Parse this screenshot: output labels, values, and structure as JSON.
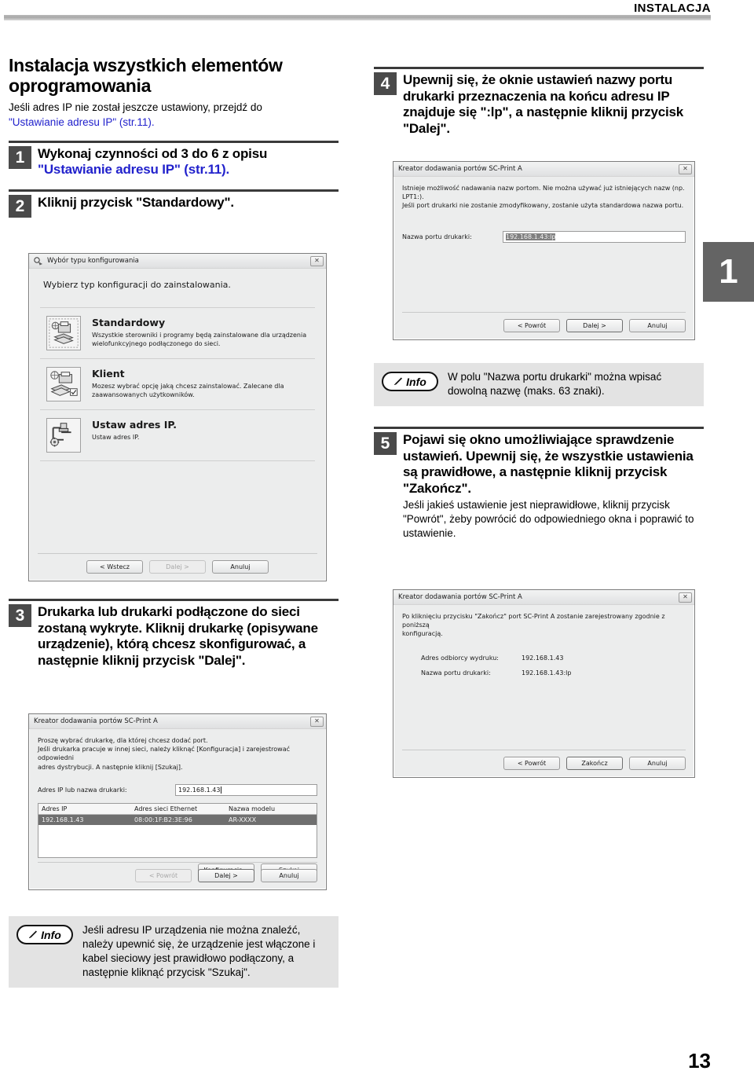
{
  "header": {
    "title": "INSTALACJA"
  },
  "side_tab": {
    "label": "1"
  },
  "footer": {
    "page_number": "13"
  },
  "section": {
    "title": "Instalacja wszystkich elementów oprogramowania",
    "intro_line1": "Jeśli adres IP nie został jeszcze ustawiony, przejdź do",
    "intro_link": "\"Ustawianie adresu IP\" (str.11)."
  },
  "steps": {
    "s1": {
      "num": "1",
      "head_plain": "Wykonaj czynności od 3 do 6 z opisu ",
      "head_link": "\"Ustawianie adresu IP\" (str.11)."
    },
    "s2": {
      "num": "2",
      "head": "Kliknij przycisk \"Standardowy\"."
    },
    "s3": {
      "num": "3",
      "head": "Drukarka lub drukarki podłączone do sieci zostaną wykryte. Kliknij drukarkę (opisywane urządzenie), którą chcesz skonfigurować, a następnie kliknij przycisk \"Dalej\"."
    },
    "s4": {
      "num": "4",
      "head": "Upewnij się, że oknie ustawień nazwy portu drukarki przeznaczenia na końcu adresu IP znajduje się \":lp\", a następnie kliknij przycisk \"Dalej\"."
    },
    "s5": {
      "num": "5",
      "head": "Pojawi się okno umożliwiające sprawdzenie ustawień. Upewnij się, że wszystkie ustawienia są prawidłowe, a następnie kliknij przycisk \"Zakończ\".",
      "sub": "Jeśli jakieś ustawienie jest nieprawidłowe, kliknij przycisk \"Powrót\", żeby powrócić do odpowiedniego okna i poprawić to ustawienie."
    }
  },
  "info_boxes": {
    "top_right": {
      "label": "Info",
      "text": "W polu \"Nazwa portu drukarki\" można wpisać dowolną nazwę (maks. 63 znaki)."
    },
    "bottom_left": {
      "label": "Info",
      "text": "Jeśli adresu IP urządzenia nie można znaleźć, należy upewnić się, że urządzenie jest włączone i kabel sieciowy jest prawidłowo podłączony, a następnie kliknąć przycisk \"Szukaj\"."
    }
  },
  "dialogs": {
    "config_type": {
      "title": "Wybór typu konfigurowania",
      "close": "✕",
      "intro": "Wybierz typ konfiguracji do zainstalowania.",
      "options": [
        {
          "title": "Standardowy",
          "desc": "Wszystkie sterowniki i programy będą zainstalowane dla urządzenia wielofunkcyjnego podłączonego do sieci."
        },
        {
          "title": "Klient",
          "desc": "Mozesz wybrać opcję jaką chcesz zainstalować. Zalecane dla zaawansowanych użytkowników."
        },
        {
          "title": "Ustaw adres IP.",
          "desc": "Ustaw adres IP."
        }
      ],
      "buttons": [
        {
          "label": "< Wstecz",
          "state": "enabled"
        },
        {
          "label": "Dalej >",
          "state": "disabled"
        },
        {
          "label": "Anuluj",
          "state": "enabled"
        }
      ]
    },
    "port_name": {
      "title": "Kreator dodawania portów SC-Print A",
      "close": "✕",
      "p1": "Istnieje możliwość nadawania nazw portom. Nie można używać już istniejących nazw (np. LPT1:).",
      "p2": "Jeśli port drukarki nie zostanie zmodyfikowany, zostanie użyta standardowa nazwa portu.",
      "field_label": "Nazwa portu drukarki:",
      "field_value_selected": "192.168.1.43:",
      "field_value_tail": "lp",
      "buttons": [
        {
          "label": "< Powrót",
          "state": "enabled"
        },
        {
          "label": "Dalej >",
          "state": "default"
        },
        {
          "label": "Anuluj",
          "state": "enabled"
        }
      ]
    },
    "port_search": {
      "title": "Kreator dodawania portów SC-Print A",
      "close": "✕",
      "p1": "Proszę wybrać drukarkę, dla której chcesz dodać port.",
      "p2": "Jeśli drukarka pracuje w innej sieci, należy kliknąć [Konfiguracja] i zarejestrować odpowiedni",
      "p3": "adres dystrybucji. A następnie kliknij [Szukaj].",
      "field_label": "Adres IP lub nazwa drukarki:",
      "field_value": "192.168.1.43",
      "columns": [
        "Adres IP",
        "Adres sieci Ethernet",
        "Nazwa modelu"
      ],
      "rows": [
        [
          "192.168.1.43",
          "08:00:1F:B2:3E:96",
          "AR-XXXX"
        ]
      ],
      "mid_buttons": [
        {
          "label": "Konfiguracja...",
          "state": "enabled"
        },
        {
          "label": "Szukaj",
          "state": "enabled"
        }
      ],
      "buttons": [
        {
          "label": "< Powrót",
          "state": "disabled"
        },
        {
          "label": "Dalej >",
          "state": "default"
        },
        {
          "label": "Anuluj",
          "state": "enabled"
        }
      ]
    },
    "port_finish": {
      "title": "Kreator dodawania portów SC-Print A",
      "close": "✕",
      "p1": "Po kliknięciu przycisku \"Zakończ\" port SC-Print A zostanie zarejestrowany zgodnie z poniższą",
      "p2": "konfiguracją.",
      "rows": [
        {
          "key": "Adres odbiorcy wydruku:",
          "value": "192.168.1.43"
        },
        {
          "key": "Nazwa portu drukarki:",
          "value": "192.168.1.43:lp"
        }
      ],
      "buttons": [
        {
          "label": "< Powrót",
          "state": "enabled"
        },
        {
          "label": "Zakończ",
          "state": "default"
        },
        {
          "label": "Anuluj",
          "state": "enabled"
        }
      ]
    }
  }
}
